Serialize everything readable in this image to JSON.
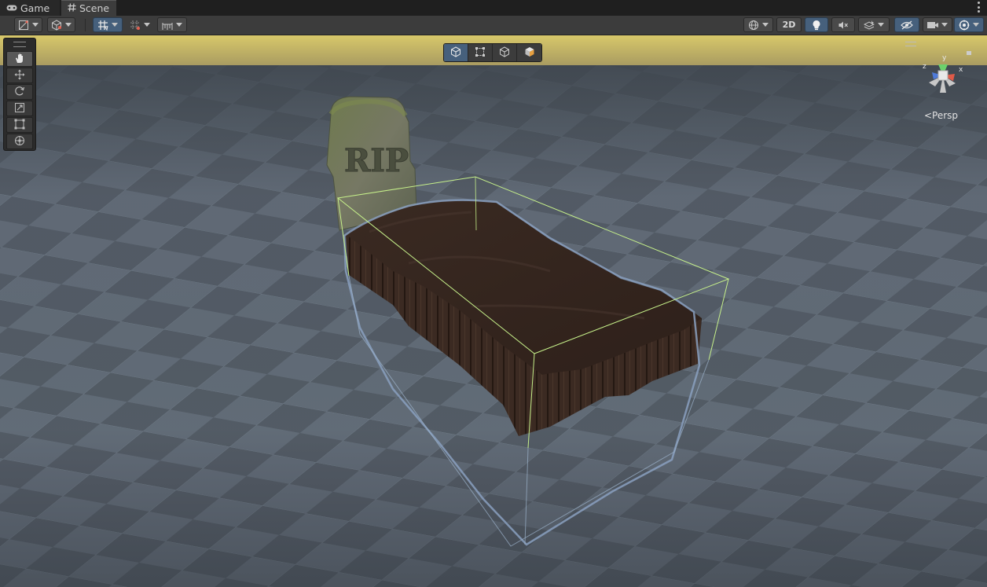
{
  "tabs": [
    {
      "label": "Game",
      "icon": "gamepad-icon"
    },
    {
      "label": "Scene",
      "icon": "hash-icon"
    }
  ],
  "toolbar": {
    "left_buttons": [
      "draw-mode-icon",
      "shading-cube-icon",
      "grid-snap-icon",
      "increment-snap-icon",
      "ruler-icon"
    ],
    "twod_label": "2D",
    "right_buttons": [
      "globe-icon",
      "lightbulb-icon",
      "audio-mute-icon",
      "effects-icon",
      "visibility-icon",
      "camera-icon",
      "gizmos-icon"
    ]
  },
  "tool_palette": [
    "hand-icon",
    "move-icon",
    "rotate-icon",
    "scale-icon",
    "rect-icon",
    "transform-icon"
  ],
  "view_toggles": [
    "cube-outline-icon",
    "rect-select-icon",
    "cube-icon",
    "cube-shaded-icon"
  ],
  "scene": {
    "tombstone_text": "RIP",
    "axis_labels": {
      "x": "x",
      "y": "y",
      "z": "z"
    },
    "projection_label": "<Persp"
  },
  "colors": {
    "accent": "#46607c",
    "sky": "#d8c86a",
    "selection_outline": "#8aa0c0",
    "bounds": "#c6f08a"
  }
}
